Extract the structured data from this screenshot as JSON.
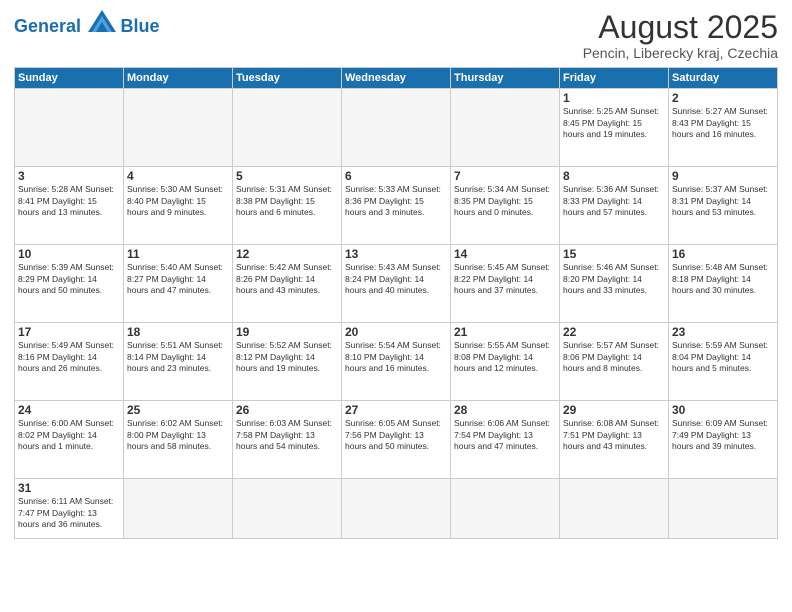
{
  "logo": {
    "text_general": "General",
    "text_blue": "Blue"
  },
  "title": "August 2025",
  "subtitle": "Pencin, Liberecky kraj, Czechia",
  "days_header": [
    "Sunday",
    "Monday",
    "Tuesday",
    "Wednesday",
    "Thursday",
    "Friday",
    "Saturday"
  ],
  "weeks": [
    [
      {
        "day": "",
        "info": ""
      },
      {
        "day": "",
        "info": ""
      },
      {
        "day": "",
        "info": ""
      },
      {
        "day": "",
        "info": ""
      },
      {
        "day": "",
        "info": ""
      },
      {
        "day": "1",
        "info": "Sunrise: 5:25 AM\nSunset: 8:45 PM\nDaylight: 15 hours\nand 19 minutes."
      },
      {
        "day": "2",
        "info": "Sunrise: 5:27 AM\nSunset: 8:43 PM\nDaylight: 15 hours\nand 16 minutes."
      }
    ],
    [
      {
        "day": "3",
        "info": "Sunrise: 5:28 AM\nSunset: 8:41 PM\nDaylight: 15 hours\nand 13 minutes."
      },
      {
        "day": "4",
        "info": "Sunrise: 5:30 AM\nSunset: 8:40 PM\nDaylight: 15 hours\nand 9 minutes."
      },
      {
        "day": "5",
        "info": "Sunrise: 5:31 AM\nSunset: 8:38 PM\nDaylight: 15 hours\nand 6 minutes."
      },
      {
        "day": "6",
        "info": "Sunrise: 5:33 AM\nSunset: 8:36 PM\nDaylight: 15 hours\nand 3 minutes."
      },
      {
        "day": "7",
        "info": "Sunrise: 5:34 AM\nSunset: 8:35 PM\nDaylight: 15 hours\nand 0 minutes."
      },
      {
        "day": "8",
        "info": "Sunrise: 5:36 AM\nSunset: 8:33 PM\nDaylight: 14 hours\nand 57 minutes."
      },
      {
        "day": "9",
        "info": "Sunrise: 5:37 AM\nSunset: 8:31 PM\nDaylight: 14 hours\nand 53 minutes."
      }
    ],
    [
      {
        "day": "10",
        "info": "Sunrise: 5:39 AM\nSunset: 8:29 PM\nDaylight: 14 hours\nand 50 minutes."
      },
      {
        "day": "11",
        "info": "Sunrise: 5:40 AM\nSunset: 8:27 PM\nDaylight: 14 hours\nand 47 minutes."
      },
      {
        "day": "12",
        "info": "Sunrise: 5:42 AM\nSunset: 8:26 PM\nDaylight: 14 hours\nand 43 minutes."
      },
      {
        "day": "13",
        "info": "Sunrise: 5:43 AM\nSunset: 8:24 PM\nDaylight: 14 hours\nand 40 minutes."
      },
      {
        "day": "14",
        "info": "Sunrise: 5:45 AM\nSunset: 8:22 PM\nDaylight: 14 hours\nand 37 minutes."
      },
      {
        "day": "15",
        "info": "Sunrise: 5:46 AM\nSunset: 8:20 PM\nDaylight: 14 hours\nand 33 minutes."
      },
      {
        "day": "16",
        "info": "Sunrise: 5:48 AM\nSunset: 8:18 PM\nDaylight: 14 hours\nand 30 minutes."
      }
    ],
    [
      {
        "day": "17",
        "info": "Sunrise: 5:49 AM\nSunset: 8:16 PM\nDaylight: 14 hours\nand 26 minutes."
      },
      {
        "day": "18",
        "info": "Sunrise: 5:51 AM\nSunset: 8:14 PM\nDaylight: 14 hours\nand 23 minutes."
      },
      {
        "day": "19",
        "info": "Sunrise: 5:52 AM\nSunset: 8:12 PM\nDaylight: 14 hours\nand 19 minutes."
      },
      {
        "day": "20",
        "info": "Sunrise: 5:54 AM\nSunset: 8:10 PM\nDaylight: 14 hours\nand 16 minutes."
      },
      {
        "day": "21",
        "info": "Sunrise: 5:55 AM\nSunset: 8:08 PM\nDaylight: 14 hours\nand 12 minutes."
      },
      {
        "day": "22",
        "info": "Sunrise: 5:57 AM\nSunset: 8:06 PM\nDaylight: 14 hours\nand 8 minutes."
      },
      {
        "day": "23",
        "info": "Sunrise: 5:59 AM\nSunset: 8:04 PM\nDaylight: 14 hours\nand 5 minutes."
      }
    ],
    [
      {
        "day": "24",
        "info": "Sunrise: 6:00 AM\nSunset: 8:02 PM\nDaylight: 14 hours\nand 1 minute."
      },
      {
        "day": "25",
        "info": "Sunrise: 6:02 AM\nSunset: 8:00 PM\nDaylight: 13 hours\nand 58 minutes."
      },
      {
        "day": "26",
        "info": "Sunrise: 6:03 AM\nSunset: 7:58 PM\nDaylight: 13 hours\nand 54 minutes."
      },
      {
        "day": "27",
        "info": "Sunrise: 6:05 AM\nSunset: 7:56 PM\nDaylight: 13 hours\nand 50 minutes."
      },
      {
        "day": "28",
        "info": "Sunrise: 6:06 AM\nSunset: 7:54 PM\nDaylight: 13 hours\nand 47 minutes."
      },
      {
        "day": "29",
        "info": "Sunrise: 6:08 AM\nSunset: 7:51 PM\nDaylight: 13 hours\nand 43 minutes."
      },
      {
        "day": "30",
        "info": "Sunrise: 6:09 AM\nSunset: 7:49 PM\nDaylight: 13 hours\nand 39 minutes."
      }
    ],
    [
      {
        "day": "31",
        "info": "Sunrise: 6:11 AM\nSunset: 7:47 PM\nDaylight: 13 hours\nand 36 minutes."
      },
      {
        "day": "",
        "info": ""
      },
      {
        "day": "",
        "info": ""
      },
      {
        "day": "",
        "info": ""
      },
      {
        "day": "",
        "info": ""
      },
      {
        "day": "",
        "info": ""
      },
      {
        "day": "",
        "info": ""
      }
    ]
  ]
}
